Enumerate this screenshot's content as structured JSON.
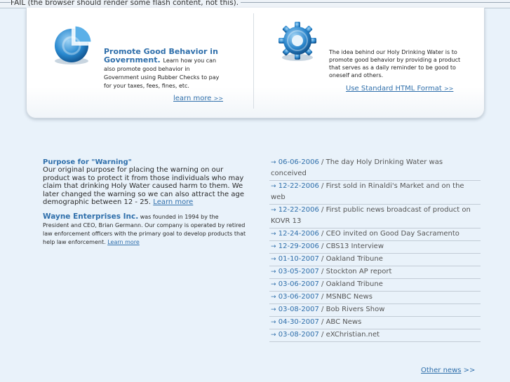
{
  "fallback_text": "FAIL (the browser should render some flash content, not this).",
  "promo": {
    "title": "Promote Good Behavior in Government.",
    "body": "Learn how you can also promote good behavior in Government using Rubber Checks to pay for your taxes, fees, fines, etc.",
    "link": "learn more",
    "link_arrows": ">>"
  },
  "idea": {
    "body": "The idea behind our Holy Drinking Water is to promote good behavior by providing a product that serves as a daily reminder to be good to oneself and others.",
    "link": "Use Standard HTML Format",
    "link_arrows": ">>"
  },
  "purpose": {
    "title": "Purpose for \"Warning\"",
    "body": "Our original purpose for placing the warning on our product was to protect it from those individuals who may claim that drinking Holy Water caused harm to them.  We later changed the warning so we can also attract the age demographic between 12 - 25.",
    "link": "Learn more"
  },
  "wayne": {
    "title": "Wayne Enterprises Inc.",
    "body": "was founded in 1994 by the President and CEO, Brian Germann. Our company is operated by retired law enforcement officers with the primary goal to develop products that help law enforcement.",
    "link": "Learn more"
  },
  "news": {
    "arrow": "→",
    "items": [
      {
        "date": "06-06-2006",
        "text": "The day Holy Drinking Water was conceived"
      },
      {
        "date": "12-22-2006",
        "text": "First sold in Rinaldi's Market and on the web"
      },
      {
        "date": "12-22-2006",
        "text": "First public news broadcast of product on KOVR 13"
      },
      {
        "date": "12-24-2006",
        "text": "CEO invited on Good Day Sacramento"
      },
      {
        "date": "12-29-2006",
        "text": "CBS13 Interview"
      },
      {
        "date": "01-10-2007",
        "text": "Oakland Tribune"
      },
      {
        "date": "03-05-2007",
        "text": "Stockton AP report"
      },
      {
        "date": "03-06-2007",
        "text": "Oakland Tribune"
      },
      {
        "date": "03-06-2007",
        "text": "MSNBC News"
      },
      {
        "date": "03-08-2007",
        "text": "Bob Rivers Show"
      },
      {
        "date": "04-30-2007",
        "text": "ABC News"
      },
      {
        "date": "03-08-2007",
        "text": "eXChristian.net"
      }
    ],
    "separator": " / ",
    "other_link": "Other news",
    "other_arrows": ">>"
  },
  "colors": {
    "accent": "#2f6fab",
    "background": "#e9f2fa"
  }
}
